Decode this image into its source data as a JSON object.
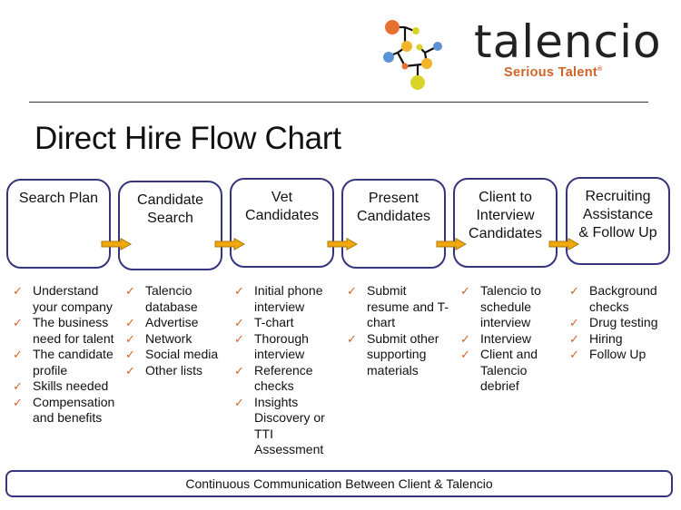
{
  "logo": {
    "wordmark": "talencio",
    "tagline": "Serious Talent",
    "registered": "®",
    "icon": "molecule-network-icon",
    "colors": {
      "orange": "#e8702e",
      "yellow": "#f3b52a",
      "lime": "#d8d42a",
      "blue": "#5b93d6",
      "tagline": "#d0652a"
    }
  },
  "title": "Direct Hire Flow Chart",
  "colors": {
    "stage_border": "#35357d",
    "arrow_fill": "#f2a80c",
    "arrow_stroke": "#a97a10",
    "check": "#d0652a"
  },
  "stages": [
    {
      "label_lines": [
        "Search Plan"
      ],
      "items": [
        "Understand your company",
        "The business need for talent",
        "The candidate profile",
        "Skills needed",
        "Compensation and benefits"
      ]
    },
    {
      "label_lines": [
        "Candidate",
        "Search"
      ],
      "items": [
        "Talencio database",
        "Advertise",
        "Network",
        "Social media",
        "Other lists"
      ]
    },
    {
      "label_lines": [
        "Vet",
        "Candidates"
      ],
      "items": [
        "Initial phone interview",
        "T-chart",
        "Thorough interview",
        "Reference checks",
        "Insights Discovery or TTI Assessment"
      ]
    },
    {
      "label_lines": [
        "Present",
        "Candidates"
      ],
      "items": [
        "Submit resume and T-chart",
        "Submit other supporting materials"
      ]
    },
    {
      "label_lines": [
        "Client to",
        "Interview",
        "Candidates"
      ],
      "items": [
        "Talencio to schedule interview",
        "Interview",
        "Client and Talencio debrief"
      ]
    },
    {
      "label_lines": [
        "Recruiting",
        "Assistance",
        "& Follow Up"
      ],
      "items": [
        "Background checks",
        "Drug testing",
        "Hiring",
        "Follow Up"
      ]
    }
  ],
  "check_glyph": "✓",
  "footer": "Continuous Communication Between Client & Talencio"
}
